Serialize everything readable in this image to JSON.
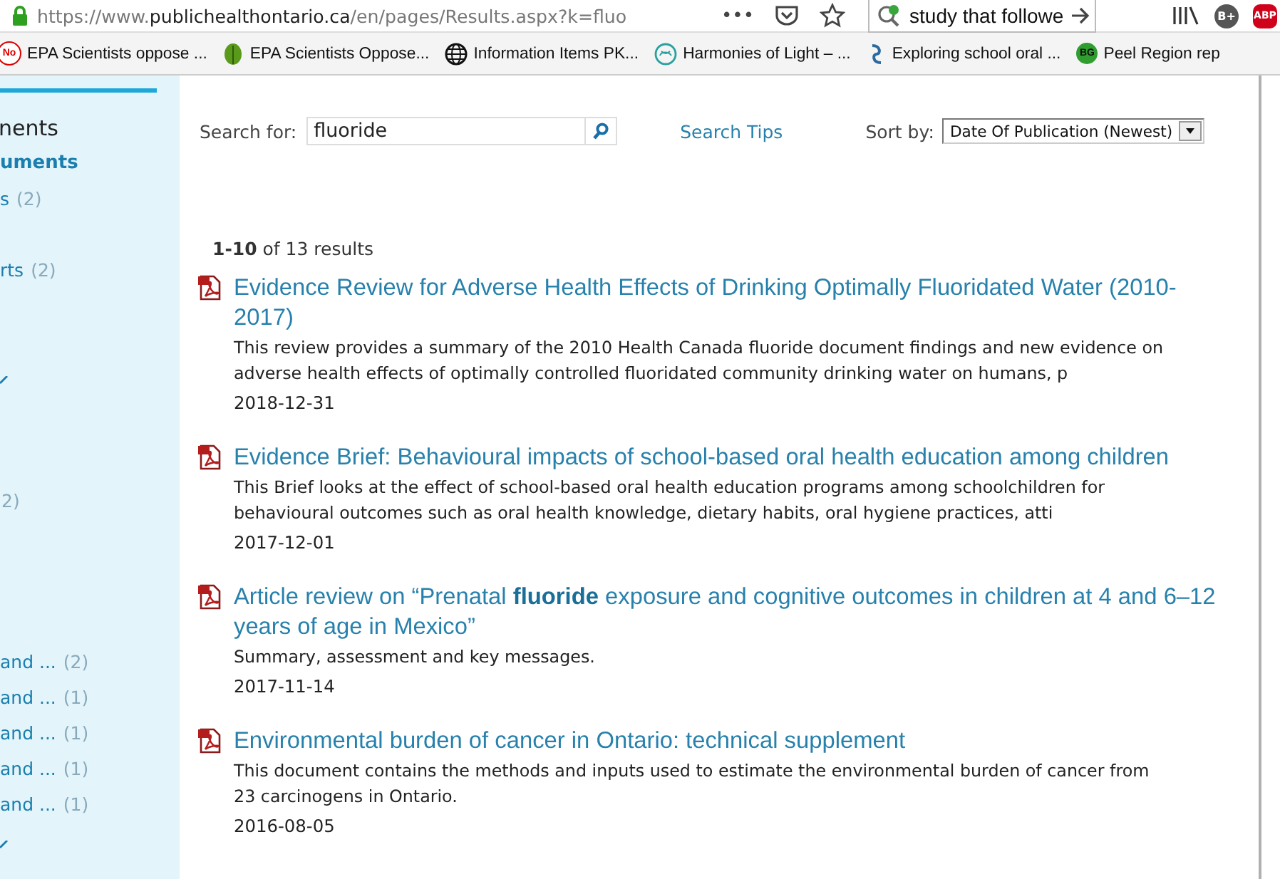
{
  "browser": {
    "url_host": "https://www.",
    "url_domain": "publichealthontario.ca",
    "url_path": "/en/pages/Results.aspx?k=fluo",
    "menu": "•••",
    "search_value": "study that followe",
    "profile_badge": "B+",
    "adblock_badge": "ABP",
    "bookmarks": [
      {
        "kind": "badge",
        "badge": "No",
        "label": "EPA Scientists oppose ..."
      },
      {
        "kind": "leaf",
        "label": "EPA Scientists Oppose..."
      },
      {
        "kind": "globe",
        "label": "Information Items PK..."
      },
      {
        "kind": "swirl",
        "label": "Harmonies of Light – ..."
      },
      {
        "kind": "twist",
        "label": "Exploring school oral ..."
      },
      {
        "kind": "badge",
        "badge": "BG",
        "label": "Peel Region rep"
      }
    ]
  },
  "sidebar": {
    "items": [
      {
        "kind": "heading",
        "text": "nents"
      },
      {
        "kind": "current",
        "text": "uments"
      },
      {
        "kind": "link",
        "text": "s",
        "count": "(2)"
      },
      {
        "kind": "link",
        "text": "rts",
        "count": "(2)"
      },
      {
        "kind": "chevron"
      },
      {
        "kind": "link",
        "count": "2)"
      },
      {
        "kind": "link",
        "text": "and ...",
        "count": "(2)"
      },
      {
        "kind": "link",
        "text": "and ...",
        "count": "(1)"
      },
      {
        "kind": "link",
        "text": "and ...",
        "count": "(1)"
      },
      {
        "kind": "link",
        "text": "and ...",
        "count": "(1)"
      },
      {
        "kind": "link",
        "text": "and ...",
        "count": "(1)"
      },
      {
        "kind": "chevron"
      }
    ]
  },
  "search": {
    "label": "Search for:",
    "value": "fluoride",
    "tips": "Search Tips",
    "sort_label": "Sort by:",
    "sort_value": "Date Of Publication (Newest)"
  },
  "summary": "**1-10** of 13 results",
  "results": [
    {
      "title": "Evidence Review for Adverse Health Effects of Drinking Optimally Fluoridated Water (2010-2017)",
      "description": "This review provides a summary of the 2010 Health Canada fluoride document findings and new evidence on adverse health effects of optimally controlled fluoridated community drinking water on humans, p",
      "date": "2018-12-31"
    },
    {
      "title": "Evidence Brief: Behavioural impacts of school-based oral health education among children",
      "description": "This Brief looks at the effect of school-based oral health education programs among schoolchildren for behavioural outcomes such as oral health knowledge, dietary habits, oral hygiene practices, atti",
      "date": "2017-12-01"
    },
    {
      "title": "Article review on “Prenatal **fluoride** exposure and cognitive outcomes in children at 4 and 6–12 years of age in Mexico”",
      "description": "Summary, assessment and key messages.",
      "date": "2017-11-14"
    },
    {
      "title": "Environmental burden of cancer in Ontario: technical supplement",
      "description": "This document contains the methods and inputs used to estimate the environmental burden of cancer from 23 carcinogens in Ontario.",
      "date": "2016-08-05"
    }
  ]
}
